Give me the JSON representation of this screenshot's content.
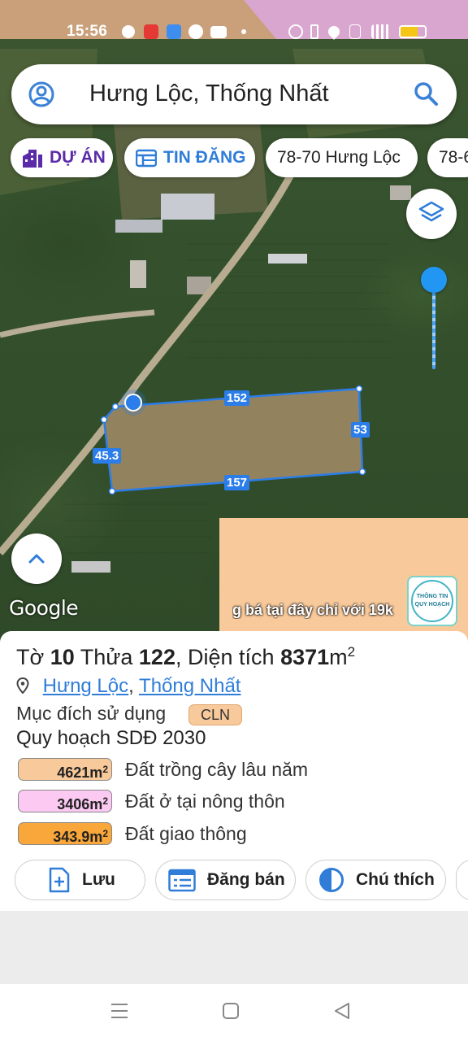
{
  "status_bar": {
    "time": "15:56",
    "icons": [
      "messenger-icon",
      "video-icon",
      "files-icon",
      "browser-icon",
      "youtube-icon",
      "dot-icon",
      "alarm-icon",
      "bluetooth-icon",
      "location-icon",
      "volte-icon",
      "signal-4g-icon",
      "battery-icon"
    ]
  },
  "search": {
    "query": "Hưng Lộc, Thống Nhất",
    "icons": [
      "account-icon",
      "search-icon"
    ]
  },
  "chips": [
    {
      "label": "DỰ ÁN",
      "icon": "building-icon"
    },
    {
      "label": "TIN ĐĂNG",
      "icon": "listing-icon"
    },
    {
      "label": "78-70 Hưng Lộc"
    },
    {
      "label": "78-6"
    }
  ],
  "map": {
    "parcel_edges": {
      "top": "152",
      "right": "53",
      "bottom": "157",
      "left": "45.3"
    },
    "attribution": "Google",
    "promo_text": "g bá tại đây chỉ với 19k",
    "badge": {
      "line1": "THÔNG TIN",
      "line2": "QUY HOẠCH"
    },
    "colors": {
      "parcel_outline": "#2b7de9",
      "planning_overlay": "#f8c99a"
    }
  },
  "parcel": {
    "sheet_label": "Tờ",
    "sheet": "10",
    "lot_label": "Thửa",
    "lot": "122",
    "area_label": "Diện tích",
    "area": "8371",
    "area_unit": "m",
    "area_unit_sup": "2",
    "commune": "Hưng Lộc",
    "district": "Thống Nhất",
    "purpose_label": "Mục đích sử dụng",
    "purpose_code": "CLN",
    "plan_title": "Quy hoạch SDĐ 2030",
    "zones": [
      {
        "area": "4621m",
        "unit_sup": "2",
        "label": "Đất trồng cây lâu năm",
        "color": "#f8c99a"
      },
      {
        "area": "3406m",
        "unit_sup": "2",
        "label": "Đất ở tại nông thôn",
        "color": "#fcc9f3"
      },
      {
        "area": "343.9m",
        "unit_sup": "2",
        "label": "Đất giao thông",
        "color": "#f9a63a"
      }
    ]
  },
  "actions": [
    {
      "label": "Lưu",
      "icon": "add-file-icon"
    },
    {
      "label": "Đăng bán",
      "icon": "calendar-list-icon"
    },
    {
      "label": "Chú thích",
      "icon": "half-circle-icon"
    }
  ],
  "nav": {
    "icons": [
      "menu-icon",
      "home-icon",
      "back-icon"
    ]
  }
}
